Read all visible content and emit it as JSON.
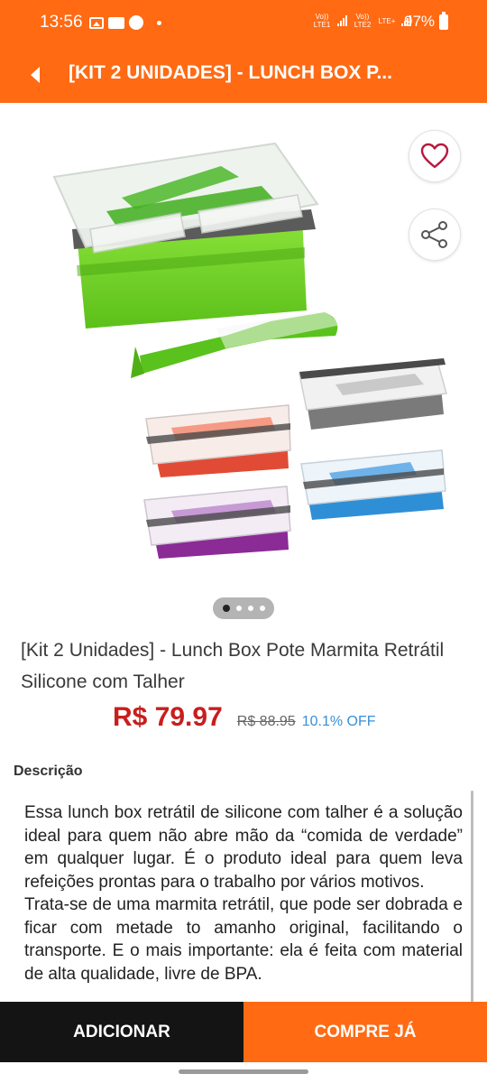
{
  "status_bar": {
    "time": "13:56",
    "sim1_label": "Vo)) LTE1",
    "sim2_label": "Vo)) LTE2",
    "sim2_extra": "LTE+",
    "battery": "97%"
  },
  "app_bar": {
    "title": "[KIT 2 UNIDADES] - LUNCH BOX P..."
  },
  "gallery": {
    "current_image": 1,
    "image_count": 4
  },
  "product": {
    "title": "[Kit 2 Unidades] - Lunch Box Pote Marmita Retrátil Silicone com Talher",
    "price": "R$ 79.97",
    "old_price": "R$ 88.95",
    "discount": "10.1% OFF"
  },
  "description": {
    "label": "Descrição",
    "text": "Essa lunch box retrátil de silicone com talher é a solução ideal para quem não abre mão da “comida de verdade” em qualquer lugar. É o produto ideal para quem leva refeições prontas para o trabalho por vários motivos.\nTrata-se de uma marmita retrátil, que pode ser dobrada e ficar com metade to amanho original, facilitando o transporte. E o mais importante: ela é feita com material de alta qualidade, livre de BPA."
  },
  "actions": {
    "add_label": "ADICIONAR",
    "buy_label": "COMPRE JÁ"
  },
  "colors": {
    "brand_orange": "#ff6a13",
    "price_red": "#c81e1e",
    "discount_blue": "#3a8fd8",
    "add_button": "#141414"
  },
  "icons": {
    "back": "arrow-left-icon",
    "favorite": "heart-icon",
    "share": "share-icon"
  }
}
